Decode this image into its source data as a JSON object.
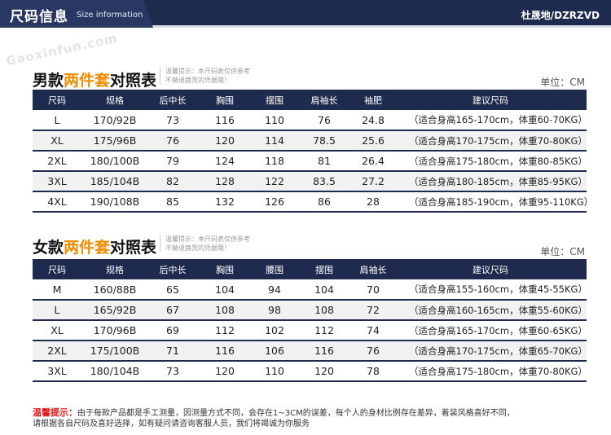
{
  "header": {
    "title_cn": "尺码信息",
    "title_en": "Size information",
    "brand": "杜晟地/DZRZVD"
  },
  "watermark": "Gaoxinfun.com",
  "men": {
    "title_pre": "男款",
    "title_hl": "两件套",
    "title_post": "对照表",
    "notice_line1": "温馨提示：本尺码表仅供参考",
    "notice_line2": "不做退换货的凭据哦！",
    "unit": "单位：CM",
    "columns": [
      "尺码",
      "规格",
      "后中长",
      "胸围",
      "摆围",
      "肩袖长",
      "袖肥",
      "建议尺码"
    ],
    "rows": [
      [
        "L",
        "170/92B",
        "73",
        "116",
        "110",
        "76",
        "24.8",
        "（适合身高165-170cm，体重60-70KG）"
      ],
      [
        "XL",
        "175/96B",
        "76",
        "120",
        "114",
        "78.5",
        "25.6",
        "（适合身高170-175cm，体重70-80KG）"
      ],
      [
        "2XL",
        "180/100B",
        "79",
        "124",
        "118",
        "81",
        "26.4",
        "（适合身高175-180cm，体重80-85KG）"
      ],
      [
        "3XL",
        "185/104B",
        "82",
        "128",
        "122",
        "83.5",
        "27.2",
        "（适合身高180-185cm，体重85-95KG）"
      ],
      [
        "4XL",
        "190/108B",
        "85",
        "132",
        "126",
        "86",
        "28",
        "（适合身高185-190cm，体重95-110KG）"
      ]
    ]
  },
  "women": {
    "title_pre": "女款",
    "title_hl": "两件套",
    "title_post": "对照表",
    "notice_line1": "温馨提示：本尺码表仅供参考",
    "notice_line2": "不做退换货的凭据哦！",
    "unit": "单位：CM",
    "columns": [
      "尺码",
      "规格",
      "后中长",
      "胸围",
      "腰围",
      "摆围",
      "肩袖长",
      "建议尺码"
    ],
    "rows": [
      [
        "M",
        "160/88B",
        "65",
        "104",
        "94",
        "104",
        "70",
        "（适合身高155-160cm，体重45-55KG）"
      ],
      [
        "L",
        "165/92B",
        "67",
        "108",
        "98",
        "108",
        "72",
        "（适合身高160-165cm，体重55-60KG）"
      ],
      [
        "XL",
        "170/96B",
        "69",
        "112",
        "102",
        "112",
        "74",
        "（适合身高165-170cm，体重60-65KG）"
      ],
      [
        "2XL",
        "175/100B",
        "71",
        "116",
        "106",
        "116",
        "76",
        "（适合身高170-175cm，体重65-70KG）"
      ],
      [
        "3XL",
        "180/104B",
        "73",
        "120",
        "110",
        "120",
        "78",
        "（适合身高175-180cm，体重70-80KG）"
      ]
    ]
  },
  "tips": {
    "label": "温馨提示：",
    "line1": "由于每款产品都是手工测量，因测量方式不同，会存在1~3CM的误差，每个人的身材比例存在差异，着装风格喜好不同，",
    "line2": "请根据各自尺码及喜好选择，如有疑问请咨询客服人员，我们将竭诚为你服务"
  }
}
